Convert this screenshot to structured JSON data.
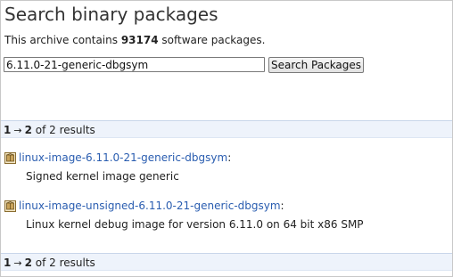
{
  "page": {
    "title": "Search binary packages",
    "summary_prefix": "This archive contains ",
    "package_count": "93174",
    "summary_suffix": " software packages."
  },
  "search": {
    "value": "6.11.0-21-generic-dbgsym",
    "button_label": "Search Packages"
  },
  "pagination": {
    "start": "1",
    "arrow": "→",
    "end": "2",
    "of_text": "of 2 results"
  },
  "results": [
    {
      "name": "linux-image-6.11.0-21-generic-dbgsym",
      "colon": ":",
      "description": "Signed kernel image generic",
      "icon": "package-icon"
    },
    {
      "name": "linux-image-unsigned-6.11.0-21-generic-dbgsym",
      "colon": ":",
      "description": "Linux kernel debug image for version 6.11.0 on 64 bit x86 SMP",
      "icon": "package-icon"
    }
  ],
  "colors": {
    "link": "#2a5db0",
    "results_bar_bg": "#eef3fb"
  }
}
